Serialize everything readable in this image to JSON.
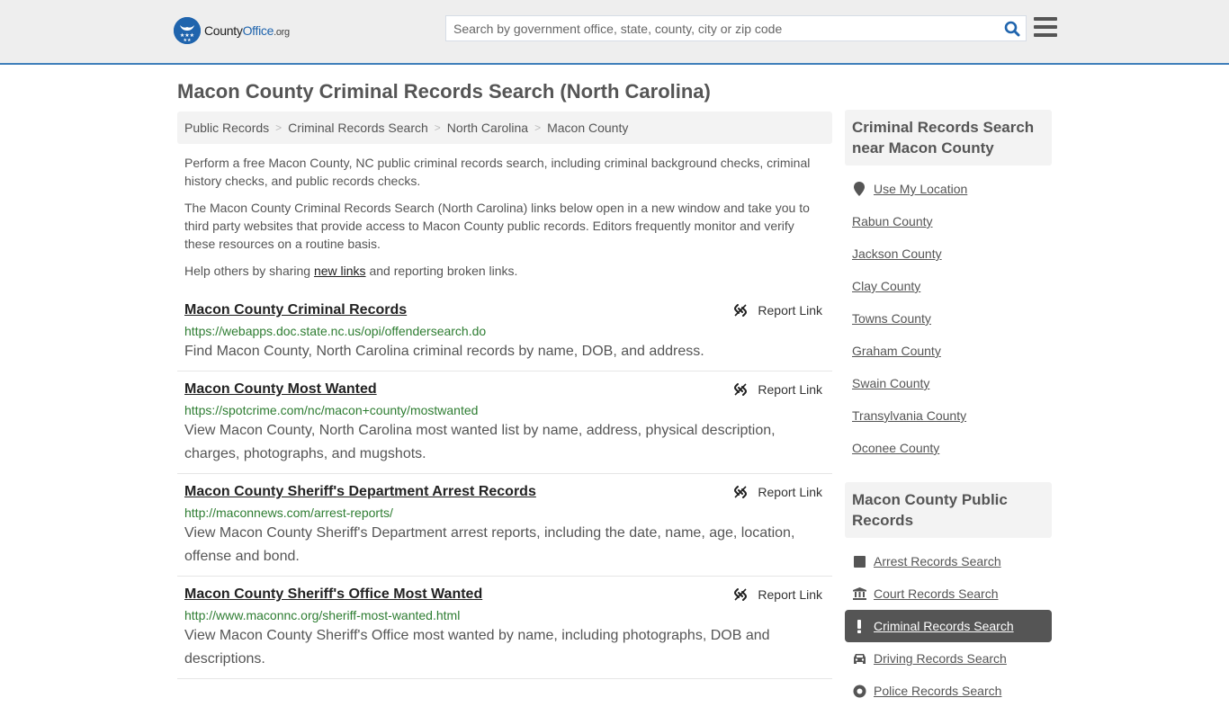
{
  "header": {
    "logo": {
      "name": "County",
      "name_accent": "Office",
      "tld": ".org"
    },
    "search": {
      "placeholder": "Search by government office, state, county, city or zip code",
      "value": ""
    },
    "colors": {
      "brand": "#1f64ad",
      "accent_line": "#3f7fba",
      "url_green": "#2e7d32"
    }
  },
  "page": {
    "title": "Macon County Criminal Records Search (North Carolina)",
    "breadcrumb": [
      "Public Records",
      "Criminal Records Search",
      "North Carolina",
      "Macon County"
    ],
    "intro": {
      "p1": "Perform a free Macon County, NC public criminal records search, including criminal background checks, criminal history checks, and public records checks.",
      "p2": "The Macon County Criminal Records Search (North Carolina) links below open in a new window and take you to third party websites that provide access to Macon County public records. Editors frequently monitor and verify these resources on a routine basis.",
      "p3_before": "Help others by sharing ",
      "p3_link": "new links",
      "p3_after": " and reporting broken links."
    },
    "report_label": "Report Link",
    "results": [
      {
        "title": "Macon County Criminal Records",
        "url": "https://webapps.doc.state.nc.us/opi/offendersearch.do",
        "description": "Find Macon County, North Carolina criminal records by name, DOB, and address."
      },
      {
        "title": "Macon County Most Wanted",
        "url": "https://spotcrime.com/nc/macon+county/mostwanted",
        "description": "View Macon County, North Carolina most wanted list by name, address, physical description, charges, photographs, and mugshots."
      },
      {
        "title": "Macon County Sheriff's Department Arrest Records",
        "url": "http://maconnews.com/arrest-reports/",
        "description": "View Macon County Sheriff's Department arrest reports, including the date, name, age, location, offense and bond."
      },
      {
        "title": "Macon County Sheriff's Office Most Wanted",
        "url": "http://www.maconnc.org/sheriff-most-wanted.html",
        "description": "View Macon County Sheriff's Office most wanted by name, including photographs, DOB and descriptions."
      }
    ]
  },
  "sidebar": {
    "nearby": {
      "heading": "Criminal Records Search near Macon County",
      "use_location": "Use My Location",
      "counties": [
        "Rabun County",
        "Jackson County",
        "Clay County",
        "Towns County",
        "Graham County",
        "Swain County",
        "Transylvania County",
        "Oconee County"
      ]
    },
    "public_records": {
      "heading": "Macon County Public Records",
      "items": [
        {
          "label": "Arrest Records Search",
          "icon": "square-icon",
          "active": false
        },
        {
          "label": "Court Records Search",
          "icon": "courthouse-icon",
          "active": false
        },
        {
          "label": "Criminal Records Search",
          "icon": "exclamation-icon",
          "active": true
        },
        {
          "label": "Driving Records Search",
          "icon": "car-icon",
          "active": false
        },
        {
          "label": "Police Records Search",
          "icon": "police-badge-icon",
          "active": false
        }
      ]
    }
  }
}
